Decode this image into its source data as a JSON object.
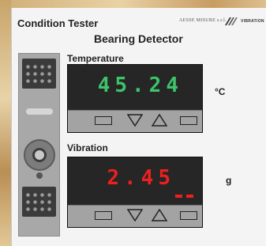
{
  "app": {
    "title": "Condition Tester",
    "subtitle": "Bearing Detector",
    "brand": "AESSE MISURE s.r.l.",
    "brand_mark": "VIBRATION"
  },
  "temperature": {
    "label": "Temperature",
    "value": "45.24",
    "unit": "°C",
    "color": "#3dc46a"
  },
  "vibration": {
    "label": "Vibration",
    "value": "2.45",
    "unit": "g",
    "color": "#ee1f1f"
  },
  "controls": [
    "rect-button",
    "down-arrow-button",
    "up-arrow-button",
    "rect-button"
  ]
}
